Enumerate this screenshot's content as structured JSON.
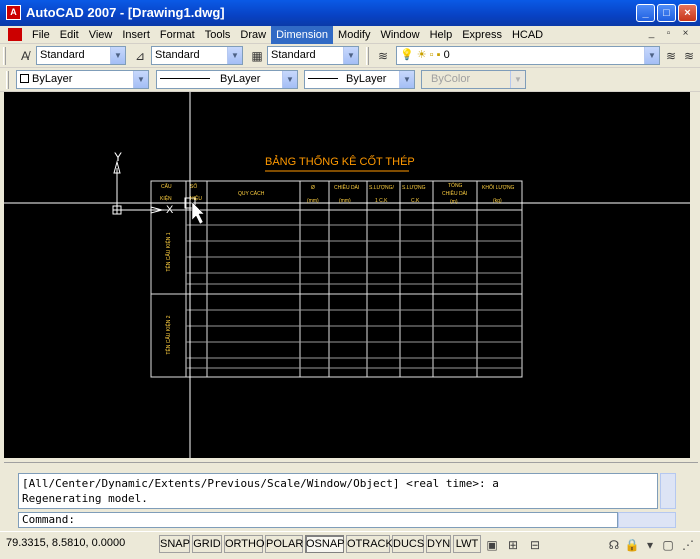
{
  "window": {
    "title": "AutoCAD 2007 - [Drawing1.dwg]",
    "app_icon": "autocad-icon",
    "controls": [
      "_",
      "□",
      "×"
    ]
  },
  "menubar": {
    "items": [
      "File",
      "Edit",
      "View",
      "Insert",
      "Format",
      "Tools",
      "Draw",
      "Dimension",
      "Modify",
      "Window",
      "Help",
      "Express",
      "HCAD"
    ],
    "active": "Dimension",
    "mdi_controls": [
      "_",
      "▫",
      "×"
    ]
  },
  "styles_toolbar": {
    "text_style": "Standard",
    "dim_style": "Standard",
    "table_style": "Standard"
  },
  "layers_toolbar": {
    "current_layer": "0"
  },
  "properties_toolbar": {
    "color": "ByLayer",
    "linetype": "ByLayer",
    "lineweight": "ByLayer",
    "plotstyle": "ByColor"
  },
  "drawing": {
    "background": "#000000",
    "crosshair_color": "#ffffff",
    "ucs_y_label": "Y",
    "ucs_x_label": "X",
    "table": {
      "title": "BẢNG THỐNG KÊ CỐT THÉP",
      "headers": [
        "CẤU KIỆN",
        "SỐ HIỆU",
        "QUY CÁCH",
        "Ø (mm)",
        "CHIỀU DÀI (mm)",
        "S.LƯỢNG/ 1 C.K",
        "S.LƯỢNG C.K",
        "TỔNG CHIỀU DÀI (m)",
        "KHỐI LƯỢNG (kg)"
      ],
      "headers_short": [
        "CẤU",
        "SỐ",
        "QUY CÁCH",
        "Ø",
        "CHIỀU DÀI",
        "S.LƯỢNG/",
        "S.LƯỢNG",
        "TỔNG",
        "KHỐI LƯỢNG"
      ],
      "header_units": [
        "KIỆN",
        "HIỆU",
        "",
        "(mm)",
        "(mm)",
        "1 C.K",
        "C.K",
        "CHIỀU DÀI",
        "(kg)"
      ],
      "units_row3": [
        "",
        "",
        "",
        "",
        "",
        "",
        "",
        "(m)",
        ""
      ],
      "groups": [
        "TÊN CẤU KIỆN 1",
        "TÊN CẤU KIỆN 2"
      ],
      "text_color": "#ffd040",
      "title_color": "#ff9900"
    }
  },
  "command": {
    "history": [
      "[All/Center/Dynamic/Extents/Previous/Scale/Window/Object] <real time>: a",
      "Regenerating model."
    ],
    "prompt": "Command:"
  },
  "statusbar": {
    "coordinates": "79.3315, 8.5810, 0.0000",
    "toggles": [
      {
        "label": "SNAP",
        "on": false
      },
      {
        "label": "GRID",
        "on": false
      },
      {
        "label": "ORTHO",
        "on": false
      },
      {
        "label": "POLAR",
        "on": false
      },
      {
        "label": "OSNAP",
        "on": true
      },
      {
        "label": "OTRACK",
        "on": false
      },
      {
        "label": "DUCS",
        "on": false
      },
      {
        "label": "DYN",
        "on": false
      },
      {
        "label": "LWT",
        "on": false
      }
    ]
  }
}
